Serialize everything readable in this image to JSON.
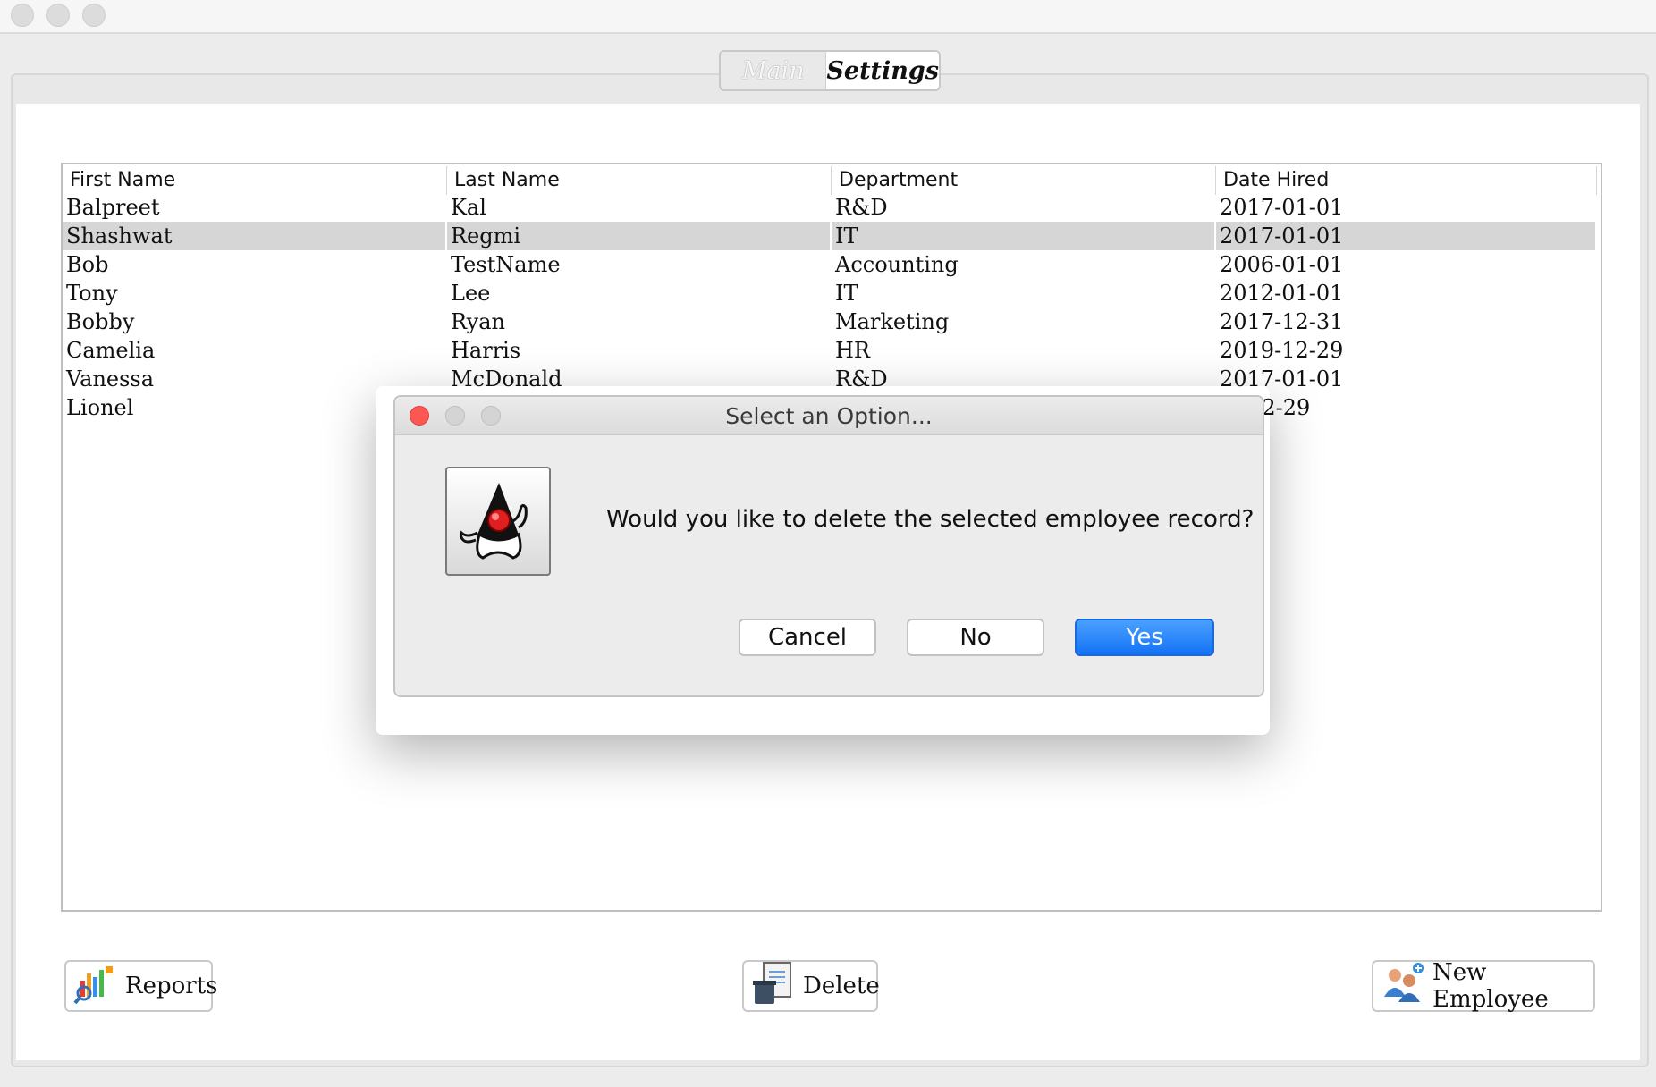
{
  "tabs": {
    "main_label": "Main",
    "settings_label": "Settings"
  },
  "table": {
    "columns": [
      "First Name",
      "Last Name",
      "Department",
      "Date Hired"
    ],
    "rows": [
      [
        "Balpreet",
        "Kal",
        "R&D",
        "2017-01-01"
      ],
      [
        "Shashwat",
        "Regmi",
        "IT",
        "2017-01-01"
      ],
      [
        "Bob",
        "TestName",
        "Accounting",
        "2006-01-01"
      ],
      [
        "Tony",
        "Lee",
        "IT",
        "2012-01-01"
      ],
      [
        "Bobby",
        "Ryan",
        "Marketing",
        "2017-12-31"
      ],
      [
        "Camelia",
        "Harris",
        "HR",
        "2019-12-29"
      ],
      [
        "Vanessa",
        "McDonald",
        "R&D",
        "2017-01-01"
      ],
      [
        "Lionel",
        "",
        "",
        "-12-29"
      ]
    ],
    "selected_row": 1
  },
  "buttons": {
    "reports_label": "Reports",
    "delete_label": "Delete",
    "new_employee_label": "New Employee"
  },
  "dialog": {
    "title": "Select an Option...",
    "message": "Would you like to delete the selected employee record?",
    "cancel_label": "Cancel",
    "no_label": "No",
    "yes_label": "Yes"
  },
  "icons": {
    "reports": "chart-magnifier-icon",
    "delete": "trash-document-icon",
    "new_employee": "add-people-icon",
    "dialog": "java-duke-icon"
  },
  "colors": {
    "accent": "#1473f5",
    "selection": "#d6d6d6",
    "close_red": "#fc5753"
  }
}
